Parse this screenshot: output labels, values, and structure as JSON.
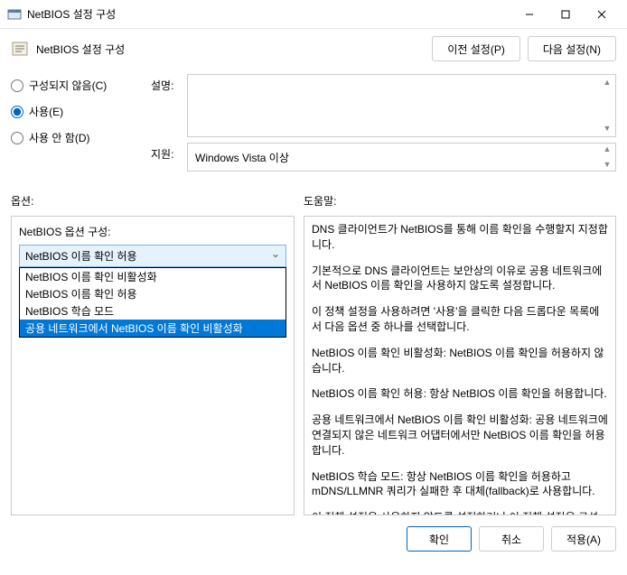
{
  "window": {
    "title": "NetBIOS 설정 구성"
  },
  "header": {
    "title": "NetBIOS 설정 구성",
    "prev": "이전 설정(P)",
    "next": "다음 설정(N)"
  },
  "radios": {
    "notConfigured": "구성되지 않음(C)",
    "enabled": "사용(E)",
    "disabled": "사용 안 함(D)"
  },
  "fields": {
    "descLabel": "설명:",
    "descValue": "",
    "supportLabel": "지원:",
    "supportValue": "Windows Vista 이상"
  },
  "sections": {
    "optionsLabel": "옵션:",
    "helpLabel": "도움말:"
  },
  "options": {
    "title": "NetBIOS 옵션 구성:",
    "selected": "NetBIOS 이름 확인 허용",
    "items": [
      "NetBIOS 이름 확인 비활성화",
      "NetBIOS 이름 확인 허용",
      "NetBIOS 학습 모드",
      "공용 네트워크에서 NetBIOS 이름 확인 비활성화"
    ],
    "highlightedIndex": 3
  },
  "help": {
    "paragraphs": [
      "DNS 클라이언트가 NetBIOS를 통해 이름 확인을 수행할지 지정합니다.",
      "기본적으로 DNS 클라이언트는 보안상의 이유로 공용 네트워크에서 NetBIOS 이름 확인을 사용하지 않도록 설정합니다.",
      "이 정책 설정을 사용하려면 '사용'을 클릭한 다음 드롭다운 목록에서 다음 옵션 중 하나를 선택합니다.",
      "NetBIOS 이름 확인 비활성화: NetBIOS 이름 확인을 허용하지 않습니다.",
      "NetBIOS 이름 확인 허용: 항상 NetBIOS 이름 확인을 허용합니다.",
      "공용 네트워크에서 NetBIOS 이름 확인 비활성화: 공용 네트워크에 연결되지 않은 네트워크 어댑터에서만 NetBIOS 이름 확인을 허용합니다.",
      "NetBIOS 학습 모드: 항상 NetBIOS 이름 확인을 허용하고 mDNS/LLMNR 쿼리가 실패한 후 대체(fallback)로 사용합니다.",
      "이 정책 설정을 사용하지 않도록 설정하거나 이 정책 설정을 구성"
    ]
  },
  "footer": {
    "ok": "확인",
    "cancel": "취소",
    "apply": "적용(A)"
  }
}
